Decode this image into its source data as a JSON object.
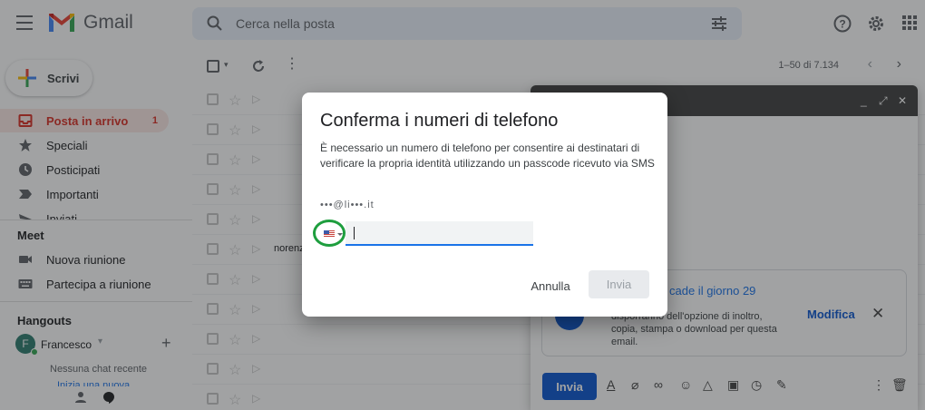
{
  "header": {
    "app_name": "Gmail",
    "search_placeholder": "Cerca nella posta"
  },
  "compose_button": "Scrivi",
  "nav": {
    "items": [
      {
        "label": "Posta in arrivo",
        "count": "1"
      },
      {
        "label": "Speciali"
      },
      {
        "label": "Posticipati"
      },
      {
        "label": "Importanti"
      },
      {
        "label": "Inviati"
      }
    ]
  },
  "meet": {
    "title": "Meet",
    "items": [
      {
        "label": "Nuova riunione"
      },
      {
        "label": "Partecipa a riunione"
      }
    ]
  },
  "hangouts": {
    "title": "Hangouts",
    "user": "Francesco",
    "avatar_initial": "F",
    "no_chats": "Nessuna chat recente",
    "start_link": "Inizia una nuova"
  },
  "list": {
    "range": "1–50 di 7.134",
    "snippet": "norenz"
  },
  "compose_window": {
    "info_title": "cade il giorno 29",
    "info_text": "disporranno dell'opzione di inoltro, copia, stampa o download per questa email.",
    "info_edit": "Modifica",
    "send": "Invia"
  },
  "dialog": {
    "title": "Conferma i numeri di telefono",
    "body": "È necessario un numero di telefono per consentire ai destinatari di verificare la propria identità utilizzando un passcode ricevuto via SMS",
    "email": "•••@li•••.it",
    "phone_value": "",
    "cancel": "Annulla",
    "send": "Invia"
  },
  "colors": {
    "accent_red": "#d93025",
    "accent_blue": "#0b57d0",
    "highlight_green": "#1e9e3e"
  }
}
